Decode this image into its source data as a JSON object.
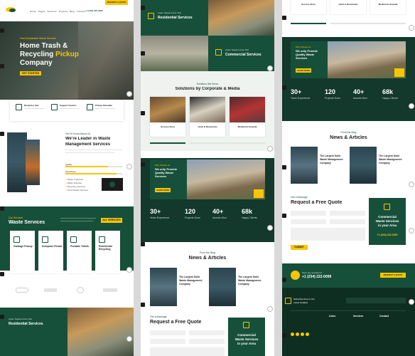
{
  "header": {
    "nav": [
      "Home",
      "Pages",
      "Services",
      "Projects",
      "Blog",
      "Contact"
    ],
    "cta": "REQUEST A QUOTE",
    "phone": "+1 (234) 222-0099"
  },
  "hero": {
    "eyebrow": "Fast Sustainable Waste Services",
    "title_1": "Home Trash &",
    "title_2": "Recycling",
    "title_highlight": "Pickup",
    "title_3": "Company",
    "button": "GET STARTED"
  },
  "features": [
    {
      "label": "Dumpster Size"
    },
    {
      "label": "Support Centers"
    },
    {
      "label": "Pickup Schedule"
    }
  ],
  "about": {
    "eyebrow": "Get To Know About Us",
    "title_1": "We're Leader in Waste",
    "title_2": "Management Services",
    "bar1": "Quality",
    "bar2": "Operations",
    "checks": [
      "Waste Collection",
      "Waste Disposal",
      "Recycling Services",
      "Smart Waste Services"
    ],
    "bar1_pct": 75,
    "bar2_pct": 90
  },
  "services": {
    "eyebrow": "Our Services",
    "title": "Waste Services",
    "button": "ALL SERVICES",
    "items": [
      "Garbage Pickup",
      "Dumpster Rental",
      "Portable Toilets",
      "Residential Recycling"
    ]
  },
  "banner": {
    "small": "Listen Speak a Free Text",
    "title": "Residential Services"
  },
  "commercial": {
    "small": "Listen Speak a Free Text",
    "title": "Commercial Services"
  },
  "solutions": {
    "eyebrow": "Solutions We Serve",
    "title": "Solutions by Corporate & Media",
    "items": [
      "Grocery Store",
      "Hotel & Restaurant",
      "Medical & Hospital"
    ]
  },
  "why": {
    "eyebrow": "Why Choose us",
    "title_1": "We only Provide",
    "title_2": "Quality Waste",
    "title_3": "Services",
    "button": "LEARN MORE"
  },
  "stats": [
    {
      "value": "30+",
      "label": "Years Experience"
    },
    {
      "value": "120",
      "label": "Projects Done"
    },
    {
      "value": "40+",
      "label": "Awards Won"
    },
    {
      "value": "68k",
      "label": "Happy Clients"
    }
  ],
  "news": {
    "eyebrow": "From the Blog",
    "title": "News & Articles",
    "post_title_1": "The Largest Solid",
    "post_title_2": "Waste Management",
    "post_title_3": "Company"
  },
  "quote": {
    "eyebrow": "Get a Message",
    "title": "Request a Free Quote",
    "button": "SUBMIT",
    "card_1": "Commercial",
    "card_2": "Waste Services",
    "card_3": "in your Area",
    "phone": "+1 (234) 222-0099"
  },
  "cta_bar": {
    "small": "Have any questions?",
    "phone": "+1 (234) 222-0099",
    "button": "REQUEST A QUOTE"
  },
  "footer": {
    "brand_1": "Subscribe Here to Our",
    "brand_2": "Latest Updates",
    "cols": [
      "Links",
      "Services",
      "Contact"
    ]
  }
}
